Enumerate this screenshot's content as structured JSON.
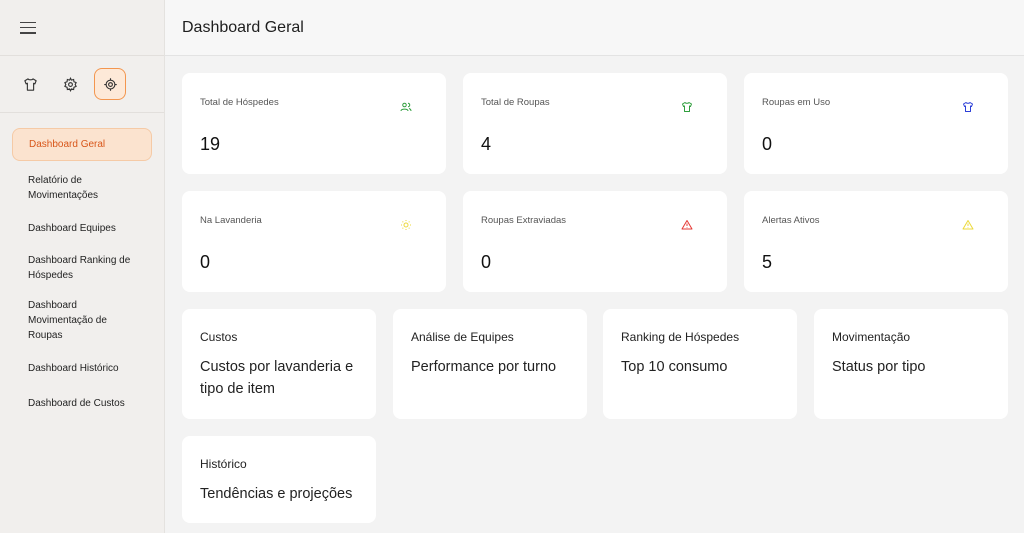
{
  "header": {
    "title": "Dashboard Geral"
  },
  "sidebar": {
    "menu_icon": "hamburger-icon",
    "top_icons": [
      {
        "name": "shirt-icon"
      },
      {
        "name": "gear-icon"
      },
      {
        "name": "target-icon",
        "active": true
      }
    ],
    "items": [
      {
        "label": "Dashboard Geral",
        "active": true
      },
      {
        "label": "Relatório de Movimentações"
      },
      {
        "label": "Dashboard Equipes"
      },
      {
        "label": "Dashboard Ranking de Hóspedes"
      },
      {
        "label": "Dashboard Movimentação de Roupas"
      },
      {
        "label": "Dashboard Histórico"
      },
      {
        "label": "Dashboard de Custos"
      }
    ]
  },
  "stats": [
    {
      "label": "Total de Hóspedes",
      "value": "19",
      "icon": "users-icon",
      "color": "#2e9e3c"
    },
    {
      "label": "Total de Roupas",
      "value": "4",
      "icon": "shirt-icon",
      "color": "#2e9e3c"
    },
    {
      "label": "Roupas em Uso",
      "value": "0",
      "icon": "shirt-icon",
      "color": "#2b3ed8"
    },
    {
      "label": "Na Lavanderia",
      "value": "0",
      "icon": "sun-icon",
      "color": "#ecd93a"
    },
    {
      "label": "Roupas Extraviadas",
      "value": "0",
      "icon": "alert-triangle-icon",
      "color": "#e53935"
    },
    {
      "label": "Alertas Ativos",
      "value": "5",
      "icon": "alert-triangle-icon",
      "color": "#ecd93a"
    }
  ],
  "links": [
    {
      "title": "Custos",
      "description": "Custos por lavanderia e tipo de item"
    },
    {
      "title": "Análise de Equipes",
      "description": "Performance por turno"
    },
    {
      "title": "Ranking de Hóspedes",
      "description": "Top 10 consumo"
    },
    {
      "title": "Movimentação",
      "description": "Status por tipo"
    },
    {
      "title": "Histórico",
      "description": "Tendências e projeções"
    }
  ],
  "colors": {
    "accent": "#f3964f",
    "accent_text": "#d8561a",
    "accent_bg": "#fbe3cf"
  }
}
